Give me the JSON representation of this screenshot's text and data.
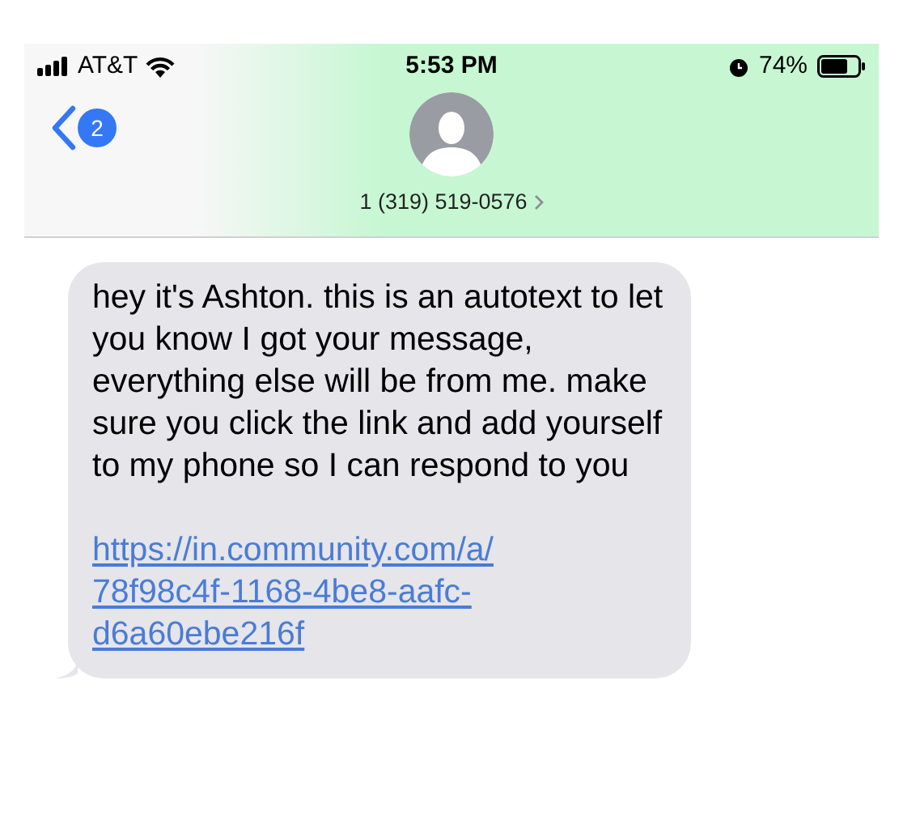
{
  "status_bar": {
    "carrier": "AT&T",
    "time": "5:53 PM",
    "battery": "74%"
  },
  "nav": {
    "back_badge": "2",
    "contact": "1 (319) 519-0576"
  },
  "messages": [
    {
      "kind": "incoming",
      "text": "hey it's Ashton. this is an autotext to let you know I got your message, everything else will be from me. make sure you click the link and add yourself to my phone so I can respond to you",
      "link_lines": [
        "https://in.community.com/a/",
        "78f98c4f-1168-4be8-aafc-",
        "d6a60ebe216f"
      ]
    }
  ]
}
